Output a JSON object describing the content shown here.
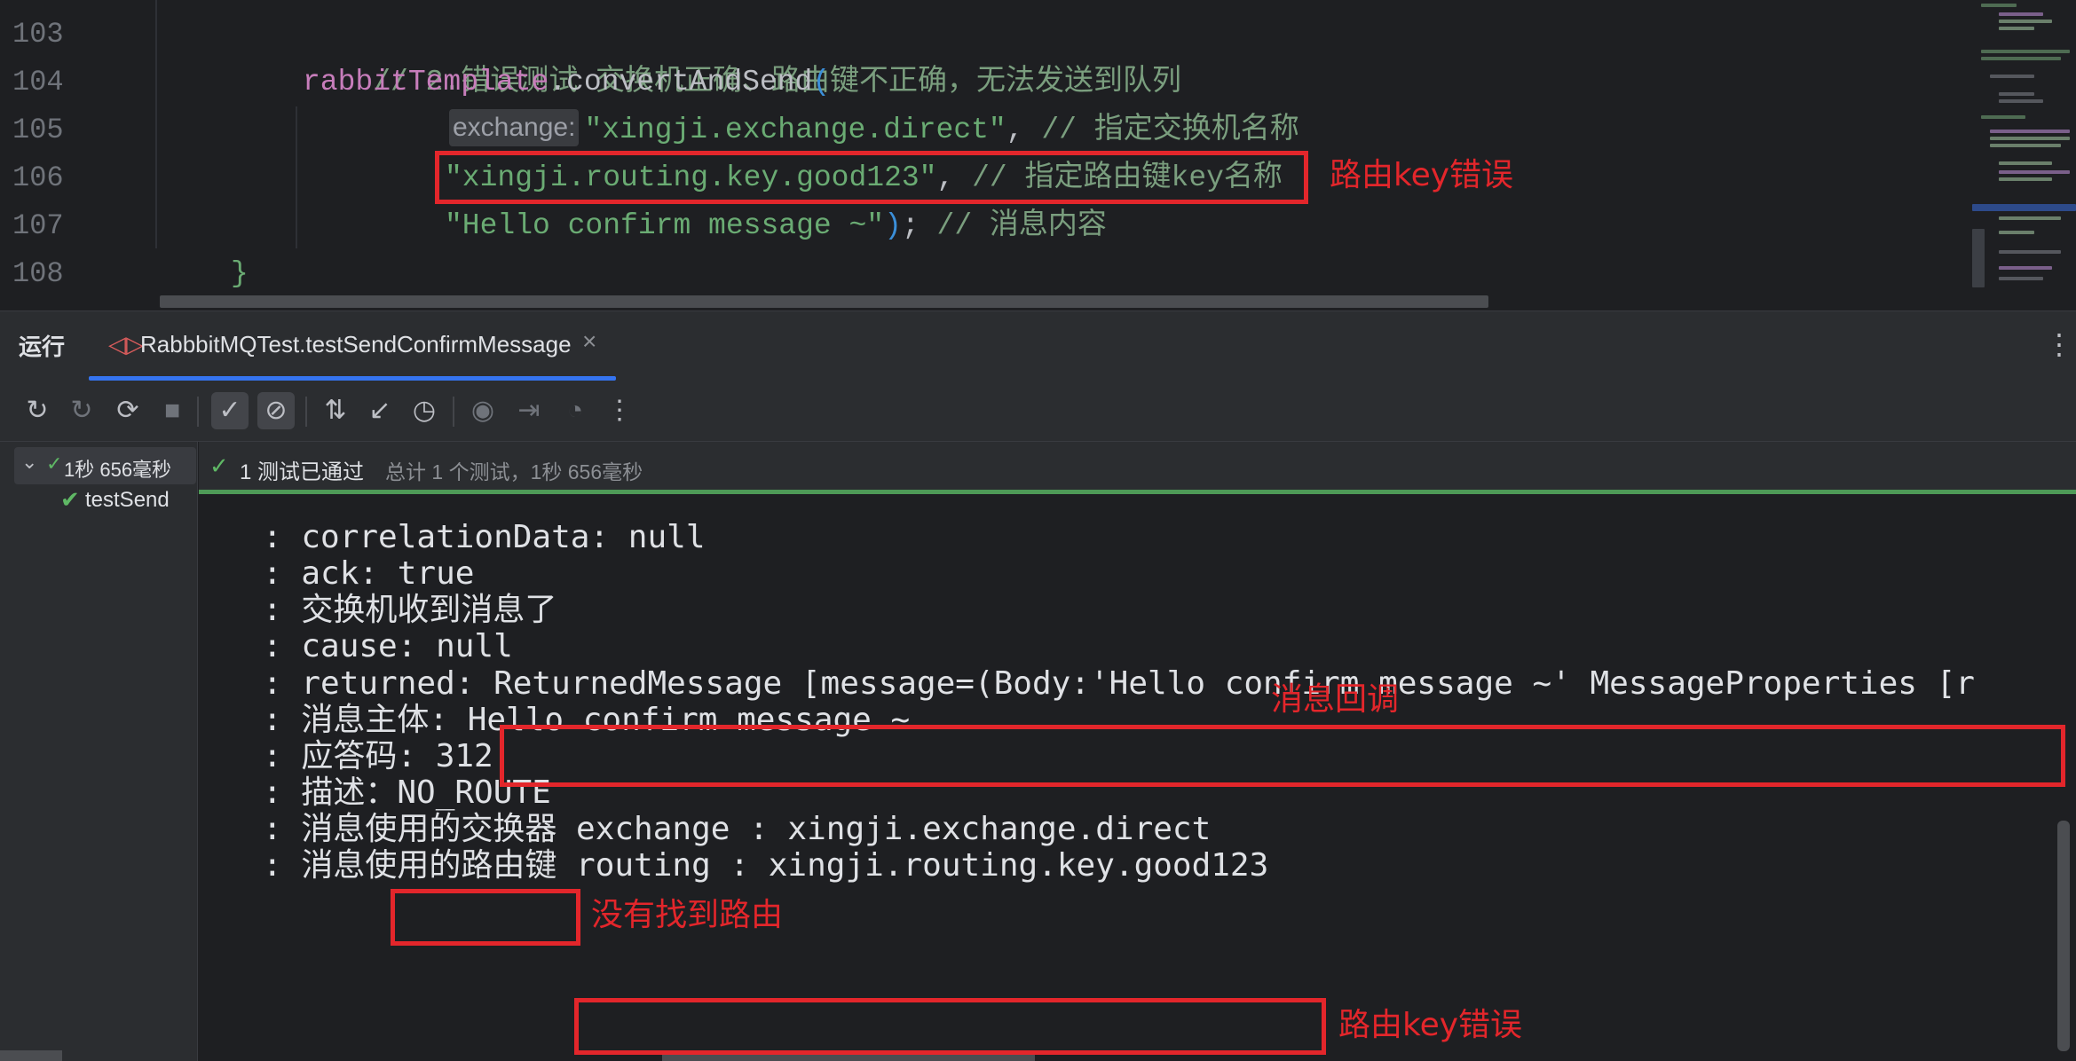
{
  "editor": {
    "line_numbers": [
      "103",
      "104",
      "105",
      "106",
      "107",
      "108"
    ],
    "line_103": {
      "comment": "// 2.错误测试 交换机正确、路由键不正确，无法发送到队列"
    },
    "line_104": {
      "object": "rabbitTemplate",
      "method": ".convertAndSend",
      "paren": "("
    },
    "line_105": {
      "hint": "exchange:",
      "value": "\"xingji.exchange.direct\"",
      "sep": ", ",
      "comment": "// 指定交换机名称"
    },
    "line_106": {
      "value": "\"xingji.routing.key.good123\"",
      "sep": ", ",
      "comment": "// 指定路由键key名称"
    },
    "line_107": {
      "value": "\"Hello confirm message ~\"",
      "close": ")",
      "semi": "; ",
      "comment": "// 消息内容"
    },
    "line_108": {
      "brace": "}"
    }
  },
  "annotations": {
    "routing_key_error_top": "路由key错误",
    "callback": "消息回调",
    "no_route": "没有找到路由",
    "routing_key_error_bottom": "路由key错误"
  },
  "run_window": {
    "title": "运行",
    "tab_label": "RabbbitMQTest.testSendConfirmMessage",
    "tab_close": "×",
    "more": "⋮"
  },
  "toolbar_icons": [
    "rerun-icon",
    "rerun-failed-icon",
    "toggle-auto-test-icon",
    "stop-icon",
    "show-passed-icon",
    "show-ignored-icon",
    "sort-icon",
    "collapse-icon",
    "history-icon",
    "screenshot-icon",
    "import-icon",
    "coverage-icon",
    "more-icon"
  ],
  "tree": {
    "root_label": "1秒 656毫秒",
    "child_label": "testSend"
  },
  "status": {
    "passed": "1 测试已通过",
    "total": "总计 1 个测试，1秒 656毫秒"
  },
  "console": {
    "lines": [
      ": correlationData: null",
      ": ack: true",
      ": 交换机收到消息了",
      ": cause: null",
      ": returned: ReturnedMessage [message=(Body:'Hello confirm message ~' MessageProperties [r",
      ": 消息主体: Hello confirm message ~",
      ": 应答码: 312",
      ": 描述：NO_ROUTE",
      ": 消息使用的交换器 exchange : xingji.exchange.direct",
      ": 消息使用的路由键 routing : xingji.routing.key.good123"
    ]
  },
  "colors": {
    "annotation_red": "#e3262b",
    "pass_green": "#5fb865",
    "accent_blue": "#3574f0"
  }
}
